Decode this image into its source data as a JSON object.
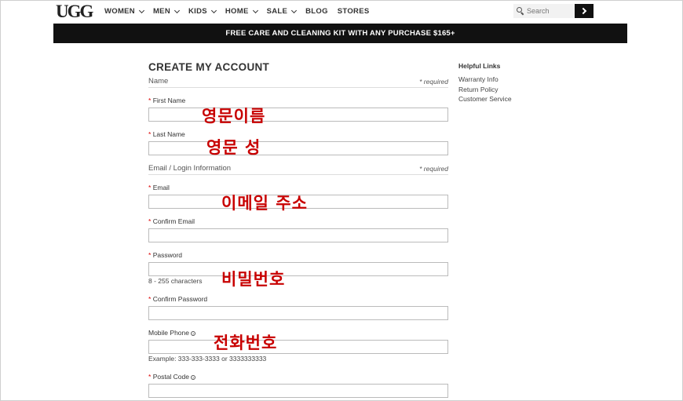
{
  "header": {
    "logo": "UGG",
    "nav": [
      {
        "label": "WOMEN",
        "dropdown": true
      },
      {
        "label": "MEN",
        "dropdown": true
      },
      {
        "label": "KIDS",
        "dropdown": true
      },
      {
        "label": "HOME",
        "dropdown": true
      },
      {
        "label": "SALE",
        "dropdown": true
      },
      {
        "label": "BLOG",
        "dropdown": false
      },
      {
        "label": "STORES",
        "dropdown": false
      }
    ],
    "search_placeholder": "Search"
  },
  "promo": "FREE CARE AND CLEANING KIT WITH ANY PURCHASE $165+",
  "form": {
    "title": "CREATE MY ACCOUNT",
    "required_note": "* required",
    "sections": {
      "name": "Name",
      "email": "Email / Login Information"
    },
    "fields": {
      "first_name": "First Name",
      "last_name": "Last Name",
      "email": "Email",
      "confirm_email": "Confirm Email",
      "password": "Password",
      "confirm_password": "Confirm Password",
      "mobile_phone": "Mobile Phone",
      "postal_code": "Postal Code"
    },
    "hints": {
      "password": "8 - 255 characters",
      "mobile_phone": "Example: 333-333-3333 or 3333333333"
    },
    "required_star": "*",
    "info_glyph": "?"
  },
  "annotations": {
    "first_name": "영문이름",
    "last_name": "영문 성",
    "email": "이메일 주소",
    "password": "비밀번호",
    "phone": "전화번호"
  },
  "sidebar": {
    "title": "Helpful Links",
    "links": [
      "Warranty Info",
      "Return Policy",
      "Customer Service"
    ]
  },
  "colors": {
    "promo_bg": "#111111",
    "annotation": "#c80000",
    "required_star": "#dd0000"
  }
}
